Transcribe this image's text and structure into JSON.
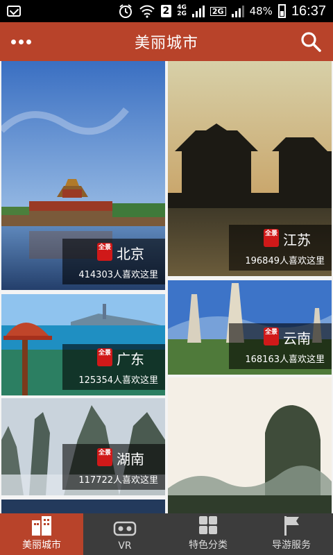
{
  "status_bar": {
    "sim_badge": "2",
    "network_1": "4G",
    "network_2": "2G",
    "network_3": "2G",
    "battery": "48%",
    "time": "16:37"
  },
  "header": {
    "title": "美丽城市",
    "more_icon": "more-dots-icon",
    "search_icon": "search-icon",
    "background_color": "#b8432a"
  },
  "cities": [
    {
      "name": "北京",
      "likes": "414303人喜欢这里",
      "seal": "全景"
    },
    {
      "name": "江苏",
      "likes": "196849人喜欢这里",
      "seal": "全景"
    },
    {
      "name": "广东",
      "likes": "125354人喜欢这里",
      "seal": "全景"
    },
    {
      "name": "云南",
      "likes": "168163人喜欢这里",
      "seal": "全景"
    },
    {
      "name": "湖南",
      "likes": "117722人喜欢这里",
      "seal": "全景"
    }
  ],
  "bottom_nav": {
    "tabs": [
      {
        "label": "美丽城市",
        "icon": "buildings-icon",
        "active": true
      },
      {
        "label": "VR",
        "icon": "vr-headset-icon",
        "active": false
      },
      {
        "label": "特色分类",
        "icon": "grid-icon",
        "active": false
      },
      {
        "label": "导游服务",
        "icon": "flag-icon",
        "active": false
      }
    ]
  }
}
